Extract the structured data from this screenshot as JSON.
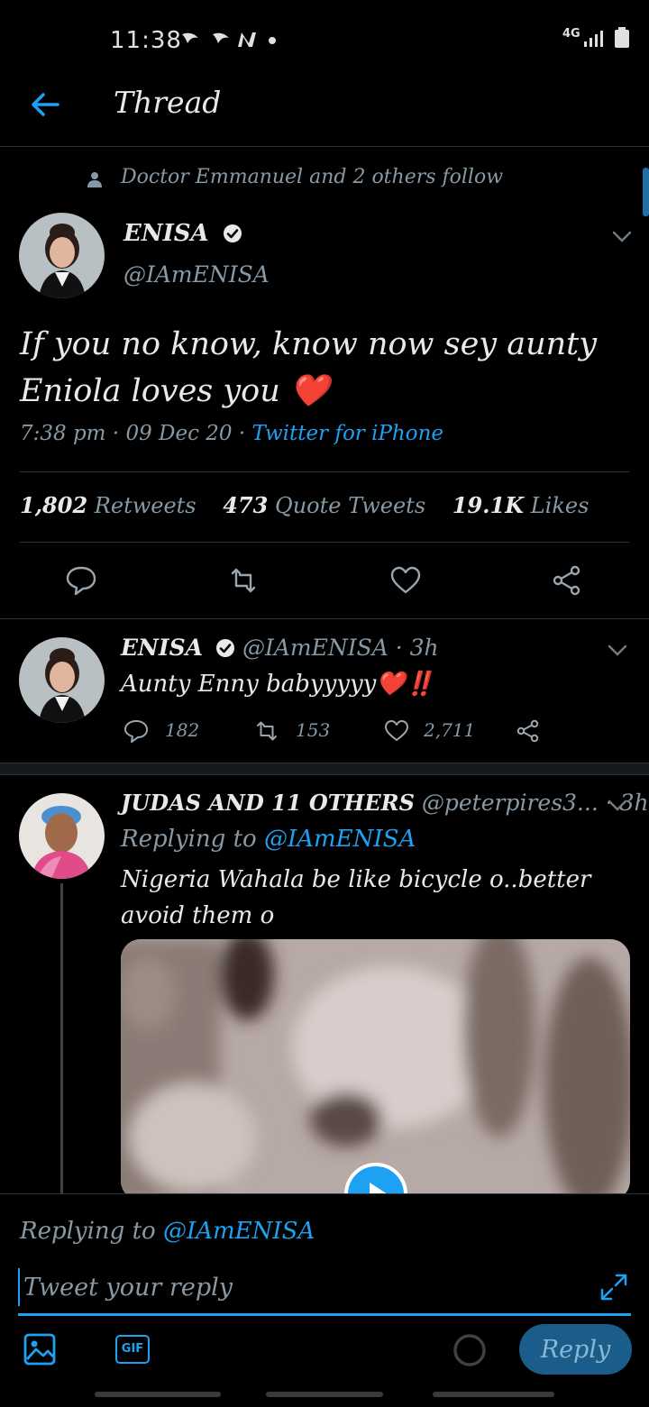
{
  "status_bar": {
    "time": "11:38",
    "network": "4G"
  },
  "header": {
    "title": "Thread",
    "back_icon": "arrow-left-icon"
  },
  "social_context": "Doctor Emmanuel and 2 others follow",
  "main_tweet": {
    "name": "ENISA",
    "handle": "@IAmENISA",
    "text": "If you no know, know now sey aunty Eniola loves you ❤️",
    "time": "7:38 pm",
    "date": "09 Dec 20",
    "sep": "·",
    "source": "Twitter for iPhone",
    "retweets_count": "1,802",
    "retweets_label": "Retweets",
    "quotes_count": "473",
    "quotes_label": "Quote Tweets",
    "likes_count": "19.1K",
    "likes_label": "Likes"
  },
  "reply1": {
    "name": "ENISA",
    "handle": "@IAmENISA",
    "age": "· 3h",
    "text": "Aunty Enny babyyyyy❤️‼️",
    "replies": "182",
    "retweets": "153",
    "likes": "2,711"
  },
  "reply2": {
    "name": "JUDAS AND 11 OTHERS",
    "handle": "@peterpires3...",
    "age": "· 3h",
    "replying_label": "Replying to",
    "replying_handle": "@IAmENISA",
    "text": "Nigeria Wahala be like bicycle o..better avoid them o"
  },
  "composer": {
    "replying_label": "Replying to",
    "replying_handle": "@IAmENISA",
    "placeholder": "Tweet your reply",
    "gif_label": "GIF",
    "reply_button": "Reply"
  },
  "colors": {
    "accent": "#1da1f2",
    "background": "#000000",
    "muted": "#8899a6"
  }
}
